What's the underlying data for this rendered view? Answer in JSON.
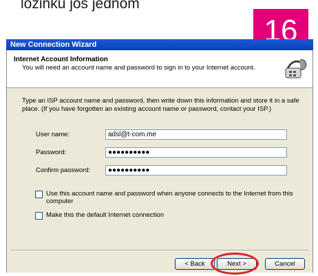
{
  "caption": "lozinku još jednom",
  "step_badge": "16",
  "window": {
    "title": "New Connection Wizard"
  },
  "header": {
    "title": "Internet Account Information",
    "subtitle": "You will need an account name and password to sign in to your Internet account.",
    "icon": "phone-connection-icon"
  },
  "intro": "Type an ISP account name and password, then write down this information and store it in a safe place. (If you have forgotten an existing account name or password, contact your ISP.)",
  "form": {
    "username_label": "User name:",
    "username_value": "adsl@t-com.me",
    "password_label": "Password:",
    "password_value": "●●●●●●●●●●",
    "confirm_label": "Confirm password:",
    "confirm_value": "●●●●●●●●●●"
  },
  "options": {
    "use_for_all_label": "Use this account  name and password when anyone connects to the Internet from this computer",
    "use_for_all_checked": false,
    "default_conn_label": "Make this the default Internet connection",
    "default_conn_checked": false
  },
  "buttons": {
    "back": "< Back",
    "next": "Next >",
    "cancel": "Cancel"
  },
  "colors": {
    "badge": "#e2007a",
    "highlight": "#d8232a",
    "titlebar": "#0a3fb8"
  }
}
